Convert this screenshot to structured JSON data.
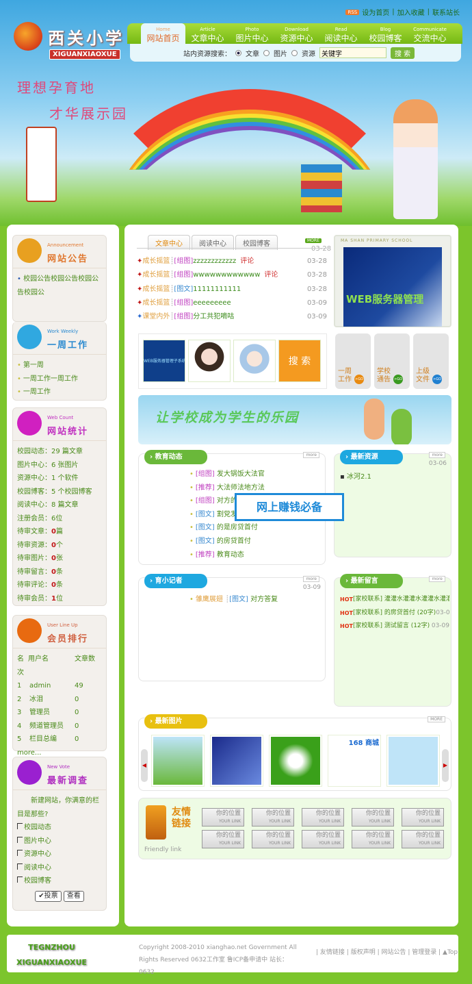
{
  "header": {
    "logo_cn": "西关小学",
    "logo_en": "XIGUANXIAOXUE",
    "rss": "RSS",
    "top_links": [
      "设为首页",
      "加入收藏",
      "联系站长"
    ],
    "nav": [
      {
        "en": "Home",
        "cn": "网站首页"
      },
      {
        "en": "Article",
        "cn": "文章中心"
      },
      {
        "en": "Photo",
        "cn": "图片中心"
      },
      {
        "en": "Download",
        "cn": "资源中心"
      },
      {
        "en": "Read",
        "cn": "阅读中心"
      },
      {
        "en": "Blog",
        "cn": "校园博客"
      },
      {
        "en": "Communicate",
        "cn": "交流中心"
      }
    ],
    "search": {
      "label": "站内资源搜索：",
      "options": [
        "文章",
        "图片",
        "资源"
      ],
      "selected": "文章",
      "keyword": "关键字",
      "button": "搜 索"
    }
  },
  "banner": {
    "slogan1": "理想孕育地",
    "slogan2": "才华展示园"
  },
  "sidebar": {
    "announcement": {
      "en": "Announcement",
      "cn": "网站公告",
      "items": [
        "校园公告校园公告校园公告校园公"
      ]
    },
    "weekly": {
      "en": "Work Weekly",
      "cn": "一周工作",
      "items": [
        "第一周",
        "一周工作一周工作",
        "一周工作"
      ]
    },
    "count": {
      "en": "Web Count",
      "cn": "网站统计",
      "rows": [
        [
          "校园动态：",
          "29 篇文章"
        ],
        [
          "图片中心：",
          "6 张图片"
        ],
        [
          "资源中心：",
          "1 个软件"
        ],
        [
          "校园博客：",
          "5 个校园博客"
        ],
        [
          "阅读中心：",
          "8 篇文章"
        ],
        [
          "注册会员：",
          "6位"
        ]
      ],
      "pending": [
        [
          "待审文章：",
          "0",
          "篇"
        ],
        [
          "待审资源：",
          "0",
          "个"
        ],
        [
          "待审图片：",
          "0",
          "张"
        ],
        [
          "待审留言：",
          "0",
          "条"
        ],
        [
          "待审评论：",
          "0",
          "条"
        ],
        [
          "待审会员：",
          "1",
          "位"
        ]
      ]
    },
    "users": {
      "en": "User Line Up",
      "cn": "会员排行",
      "headers": [
        "名次",
        "用户名",
        "文章数"
      ],
      "rows": [
        [
          "1",
          "admin",
          "49"
        ],
        [
          "2",
          "冰泪",
          "0"
        ],
        [
          "3",
          "管理员",
          "0"
        ],
        [
          "4",
          "频道管理员",
          "0"
        ],
        [
          "5",
          "栏目总编",
          "0"
        ]
      ],
      "more": "more..."
    },
    "vote": {
      "en": "New Vote",
      "cn": "最新调查",
      "question": "新建网站，你满意的栏目是那些?",
      "options": [
        "校园动态",
        "图片中心",
        "资源中心",
        "阅读中心",
        "校园博客"
      ],
      "vote_btn": "✔投票",
      "view_btn": "查看"
    }
  },
  "main": {
    "tabs": [
      "文章中心",
      "阅读中心",
      "校园博客"
    ],
    "more": "MORE",
    "top_date": "03-28",
    "news": [
      {
        "cat": "成长摇篮",
        "type": "[组图]",
        "title": "zzzzzzzzzzzz",
        "comment": "评论",
        "date": "03-28"
      },
      {
        "cat": "成长摇篮",
        "type": "[组图]",
        "title": "wwwwwwwwwwww",
        "comment": "评论",
        "date": "03-28"
      },
      {
        "cat": "成长摇篮",
        "type": "[图文]",
        "title": "11111111111",
        "date": "03-28"
      },
      {
        "cat": "成长摇篮",
        "type": "[组图]",
        "title": "eeeeeeeee",
        "date": "03-09"
      },
      {
        "cat": "课堂内外",
        "type": "[组图]",
        "title": "分工共犯嘀咕",
        "date": "03-09"
      }
    ],
    "slide": {
      "caption": "MA SHAN PRIMARY SCHOOL",
      "text": "WEB服务器管理"
    },
    "thumbs": {
      "first": "WEB服务器管理子系统",
      "search": "搜 索"
    },
    "quick": [
      {
        "label": "一周工作",
        "go": ">GO",
        "color": "#e88a10"
      },
      {
        "label": "学校通告",
        "go": ">GO",
        "color": "#3a9a20"
      },
      {
        "label": "上级文件",
        "go": ">GO",
        "color": "#2080d0"
      }
    ],
    "banner_text": "让学校成为学生的乐园",
    "edu": {
      "title": "教育动态",
      "more": "more",
      "items": [
        [
          "[组图]",
          "发大锅饭大法官"
        ],
        [
          "[推荐]",
          "大法师法地方法"
        ],
        [
          "[组图]",
          "对方的负"
        ],
        [
          "[图文]",
          "割党发第"
        ],
        [
          "[图文]",
          "的是房贷首付"
        ],
        [
          "[图文]",
          "的房贷首付"
        ],
        [
          "[推荐]",
          "教育动态"
        ]
      ]
    },
    "res": {
      "title": "最新资源",
      "more": "more",
      "date": "03-06",
      "items": [
        "冰河2.1"
      ]
    },
    "reporter": {
      "title": "育小记者",
      "more": "more",
      "date": "03-09",
      "items": [
        {
          "cat": "雏鹰展翅",
          "type": "[图文]",
          "title": "对方答复"
        }
      ]
    },
    "msgs": {
      "title": "最新留言",
      "more": "more",
      "items": [
        {
          "hot": "HOT",
          "text": "[家校联系] 灌灌水灌灌水灌灌水灌灌",
          "date": ""
        },
        {
          "hot": "HOT",
          "text": "[家校联系] 的房贷首付 (20字)",
          "date": "03-09"
        },
        {
          "hot": "HOT",
          "text": "[家校联系] 测试留言 (12字)",
          "date": "03-09"
        }
      ]
    },
    "photos": {
      "title": "最新图片",
      "more": "MORE",
      "captions": [
        "",
        "",
        "",
        "168 商城",
        ""
      ]
    },
    "friends": {
      "title": "友情链接",
      "en": "Friendly link",
      "cn_link": "你的位置",
      "en_link": "YOUR LINK"
    },
    "ad": "网上赚钱必备"
  },
  "footer": {
    "logo1": "TEGNZHOU",
    "logo2": "XIGUANXIAOXUE",
    "copyright": "Copyright 2008-2010 xianghao.net Government All Rights Reserved 0632工作室 鲁ICP备申请中 站长：0632",
    "links": [
      "友情链接",
      "版权声明",
      "网站公告",
      "管理登录"
    ],
    "top": "▲Top"
  }
}
